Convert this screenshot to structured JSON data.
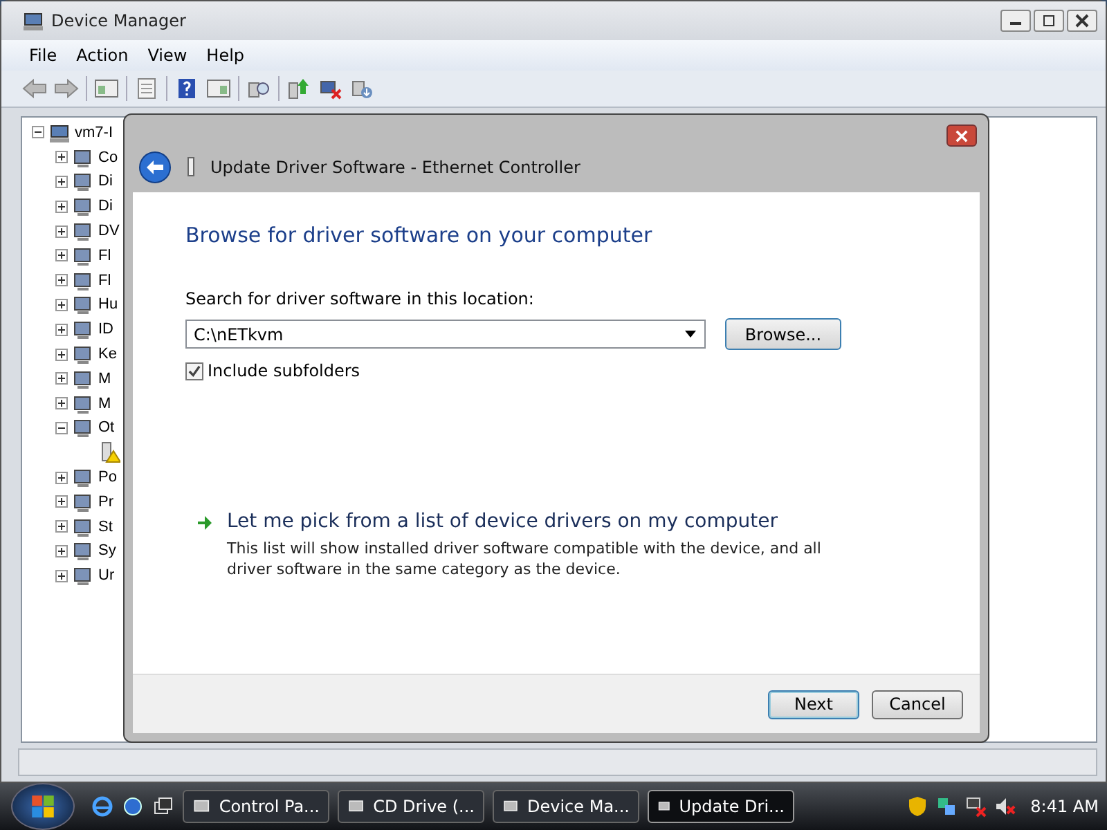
{
  "window": {
    "title": "Device Manager"
  },
  "menu": [
    "File",
    "Action",
    "View",
    "Help"
  ],
  "tree": {
    "label": "vm7-I",
    "expanded": true,
    "children": [
      {
        "label": "Co",
        "expanded": false
      },
      {
        "label": "Di",
        "expanded": false
      },
      {
        "label": "Di",
        "expanded": false
      },
      {
        "label": "DV",
        "expanded": false
      },
      {
        "label": "Fl",
        "expanded": false
      },
      {
        "label": "Fl",
        "expanded": false
      },
      {
        "label": "Hu",
        "expanded": false
      },
      {
        "label": "ID",
        "expanded": false
      },
      {
        "label": "Ke",
        "expanded": false
      },
      {
        "label": "M",
        "expanded": false
      },
      {
        "label": "M",
        "expanded": false
      },
      {
        "label": "Ot",
        "expanded": true,
        "children": [
          {
            "warning": true
          }
        ]
      },
      {
        "label": "Po",
        "expanded": false
      },
      {
        "label": "Pr",
        "expanded": false
      },
      {
        "label": "St",
        "expanded": false
      },
      {
        "label": "Sy",
        "expanded": false
      },
      {
        "label": "Ur",
        "expanded": false
      }
    ]
  },
  "dialog": {
    "title": "Update Driver Software - Ethernet Controller",
    "heading": "Browse for driver software on your computer",
    "location_label": "Search for driver software in this location:",
    "location_value": "C:\\nETkvm",
    "browse_button": "Browse...",
    "include_subfolders": {
      "label": "Include subfolders",
      "checked": true
    },
    "pick_option": {
      "title": "Let me pick from a list of device drivers on my computer",
      "description": "This list will show installed driver software compatible with the device, and all driver software in the same category as the device."
    },
    "buttons": [
      {
        "label": "Next",
        "default": true
      },
      {
        "label": "Cancel",
        "default": false
      }
    ]
  },
  "taskbar": {
    "tasks": [
      {
        "label": "Control Pa...",
        "selected": false
      },
      {
        "label": "CD Drive (...",
        "selected": false
      },
      {
        "label": "Device Ma...",
        "selected": false
      },
      {
        "label": "Update Dri...",
        "selected": true
      }
    ],
    "clock": "8:41 AM"
  }
}
